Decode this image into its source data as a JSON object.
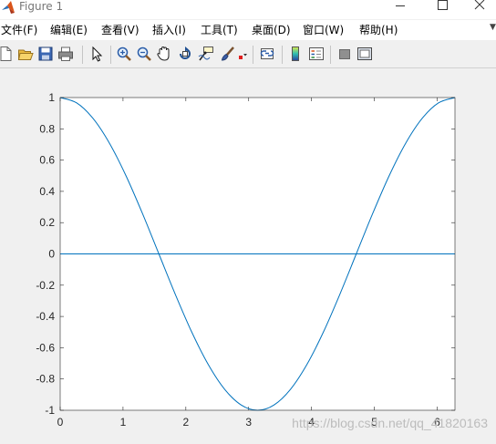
{
  "window": {
    "title": "Figure 1",
    "controls": {
      "minimize": "minimize",
      "maximize": "maximize",
      "close": "close"
    }
  },
  "menu": [
    {
      "label": "文件(F)"
    },
    {
      "label": "编辑(E)"
    },
    {
      "label": "查看(V)"
    },
    {
      "label": "插入(I)"
    },
    {
      "label": "工具(T)"
    },
    {
      "label": "桌面(D)"
    },
    {
      "label": "窗口(W)"
    },
    {
      "label": "帮助(H)"
    }
  ],
  "toolbar": {
    "buttons": [
      {
        "icon": "new-figure-icon"
      },
      {
        "icon": "open-file-icon"
      },
      {
        "icon": "save-icon"
      },
      {
        "icon": "print-icon"
      },
      {
        "icon": "edit-plot-arrow-icon"
      },
      {
        "icon": "zoom-in-icon"
      },
      {
        "icon": "zoom-out-icon"
      },
      {
        "icon": "pan-hand-icon"
      },
      {
        "icon": "rotate-3d-icon"
      },
      {
        "icon": "data-cursor-icon"
      },
      {
        "icon": "brush-icon"
      },
      {
        "icon": "link-plot-icon"
      },
      {
        "icon": "colorbar-icon"
      },
      {
        "icon": "legend-icon"
      },
      {
        "icon": "hide-plot-tools-icon"
      },
      {
        "icon": "show-plot-tools-icon"
      }
    ]
  },
  "watermark": "https://blog.csdn.net/qq_41820163",
  "colors": {
    "line": "#0072bd",
    "axes_bg": "#ffffff",
    "figure_bg": "#f0f0f0"
  },
  "chart_data": {
    "type": "line",
    "title": "",
    "xlabel": "",
    "ylabel": "",
    "xlim": [
      0,
      6.2832
    ],
    "ylim": [
      -1,
      1
    ],
    "xticks": [
      0,
      1,
      2,
      3,
      4,
      5,
      6
    ],
    "yticks": [
      1,
      0.8,
      0.6,
      0.4,
      0.2,
      0,
      -0.2,
      -0.4,
      -0.6,
      -0.8,
      -1
    ],
    "grid": false,
    "series": [
      {
        "x": [
          0,
          0.2618,
          0.5236,
          0.7854,
          1.0472,
          1.309,
          1.5708,
          1.8326,
          2.0944,
          2.3562,
          2.618,
          2.8798,
          3.1416,
          3.4034,
          3.6652,
          3.927,
          4.1888,
          4.4506,
          4.7124,
          4.9742,
          5.236,
          5.4978,
          5.7596,
          6.0214,
          6.2832
        ],
        "y": [
          1,
          0.9659,
          0.866,
          0.7071,
          0.5,
          0.2588,
          0,
          -0.2588,
          -0.5,
          -0.7071,
          -0.866,
          -0.9659,
          -1,
          -0.9659,
          -0.866,
          -0.7071,
          -0.5,
          -0.2588,
          0,
          0.2588,
          0.5,
          0.7071,
          0.866,
          0.9659,
          1
        ]
      },
      {
        "x": [
          0,
          6.2832
        ],
        "y": [
          0,
          0
        ]
      }
    ]
  }
}
